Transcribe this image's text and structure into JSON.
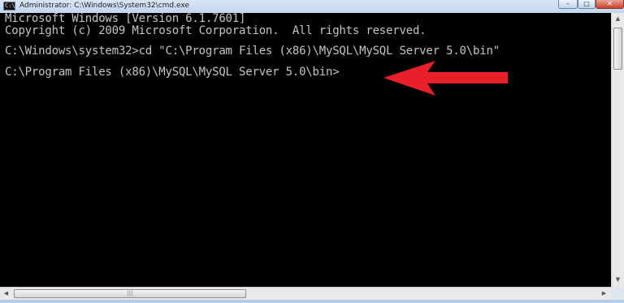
{
  "window": {
    "title": "Administrator: C:\\Windows\\System32\\cmd.exe",
    "app_icon_text": "C:\\",
    "icon": "cmd-icon"
  },
  "title_controls": {
    "minimize": "–",
    "maximize": "□",
    "close": "✕"
  },
  "console": {
    "lines": [
      "Microsoft Windows [Version 6.1.7601]",
      "Copyright (c) 2009 Microsoft Corporation.  All rights reserved.",
      "",
      "C:\\Windows\\system32>cd \"C:\\Program Files (x86)\\MySQL\\MySQL Server 5.0\\bin\"",
      "",
      "C:\\Program Files (x86)\\MySQL\\MySQL Server 5.0\\bin>"
    ],
    "text_color": "#c4c4c4",
    "background": "#000000"
  },
  "annotation": {
    "type": "arrow",
    "direction": "left",
    "color": "#e8202a"
  },
  "scrollbars": {
    "up_arrow": "▲",
    "down_arrow": "▼",
    "left_arrow": "◀",
    "right_arrow": "▶",
    "grip": "|||"
  }
}
